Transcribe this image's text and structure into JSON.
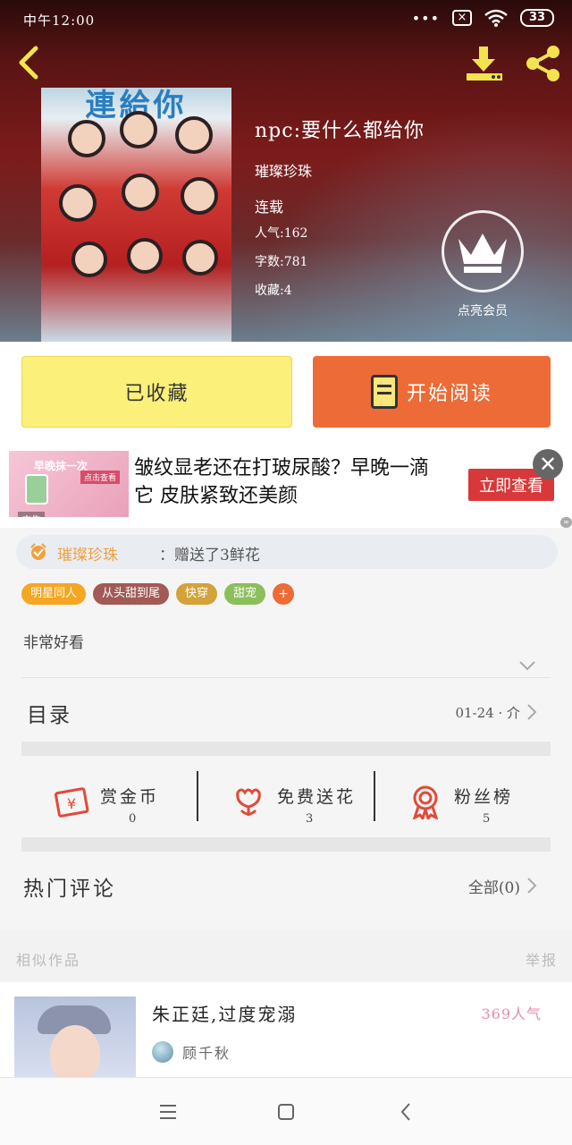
{
  "status_bar": {
    "time": "中午12:00",
    "signal": "•••",
    "battery": "33"
  },
  "book": {
    "cover_title": "連給你",
    "title": "npc:要什么都给你",
    "author": "璀璨珍珠",
    "status": "连载",
    "popularity": "人气:162",
    "word_count": "字数:781",
    "favorites": "收藏:4"
  },
  "vip": {
    "label": "点亮会员"
  },
  "actions": {
    "collected_label": "已收藏",
    "read_label": "开始阅读"
  },
  "ad": {
    "image_text": "早晚抹一次",
    "image_badge": "点击查看",
    "tag": "广告",
    "text": "皱纹显老还在打玻尿酸？早晚一滴它 皮肤紧致还美颜",
    "cta": "立即查看",
    "close": "✕"
  },
  "gift": {
    "user": "璀璨珍珠",
    "text": "：赠送了3鲜花"
  },
  "tags": [
    {
      "label": "明星同人",
      "color": "#f5a623"
    },
    {
      "label": "从头甜到尾",
      "color": "#a15a55"
    },
    {
      "label": "快穿",
      "color": "#d4a23a"
    },
    {
      "label": "甜宠",
      "color": "#8bbf5b"
    },
    {
      "label": "+",
      "color": "#ec6b37"
    }
  ],
  "description": "非常好看",
  "toc": {
    "label": "目录",
    "range": "01-24 · 介"
  },
  "stats": [
    {
      "label": "赏金币",
      "value": "0",
      "icon": "red-envelope-icon"
    },
    {
      "label": "免费送花",
      "value": "3",
      "icon": "flower-icon"
    },
    {
      "label": "粉丝榜",
      "value": "5",
      "icon": "medal-icon"
    }
  ],
  "comments": {
    "label": "热门评论",
    "all": "全部(0)"
  },
  "similar": {
    "title": "相似作品",
    "report": "举报",
    "items": [
      {
        "title": "朱正廷,过度宠溺",
        "popularity": "369人气",
        "author": "顾千秋"
      }
    ]
  },
  "colors": {
    "accent_orange": "#ec6b37",
    "collected_yellow": "#fbf07a",
    "icon_red": "#e04a3a",
    "gift_user": "#f0a13c",
    "popularity_pink": "#e88aa9"
  }
}
